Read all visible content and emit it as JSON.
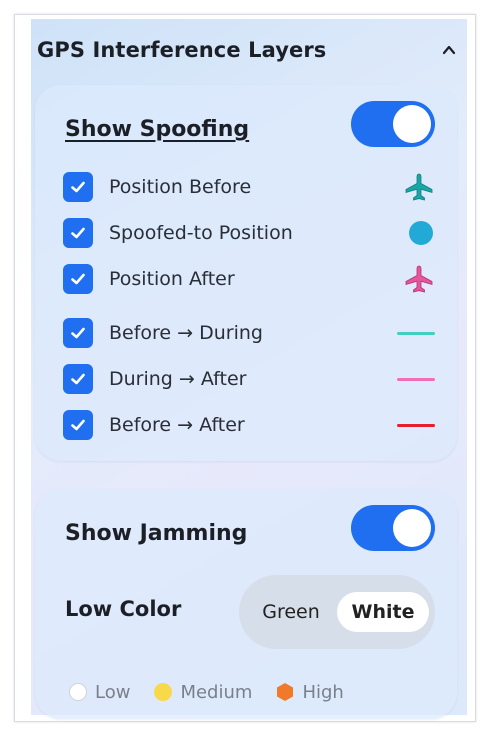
{
  "panel": {
    "title": "GPS Interference Layers",
    "collapse_icon": "chevron-up-icon"
  },
  "spoofing": {
    "title": "Show Spoofing",
    "toggle_on": true,
    "items": [
      {
        "label": "Position Before",
        "checked": true,
        "symbol": "airplane-icon",
        "color": "#1aa6a6"
      },
      {
        "label": "Spoofed-to Position",
        "checked": true,
        "symbol": "circle",
        "color": "#22a9d6"
      },
      {
        "label": "Position After",
        "checked": true,
        "symbol": "airplane-icon",
        "color": "#e8559a"
      },
      {
        "label": "Before → During",
        "checked": true,
        "symbol": "line",
        "color": "#3fd0bf"
      },
      {
        "label": "During → After",
        "checked": true,
        "symbol": "line",
        "color": "#f06fb8"
      },
      {
        "label": "Before → After",
        "checked": true,
        "symbol": "line",
        "color": "#e61e2e"
      }
    ]
  },
  "jamming": {
    "title": "Show Jamming",
    "toggle_on": true,
    "low_color_label": "Low Color",
    "options": [
      "Green",
      "White"
    ],
    "selected_option": "White",
    "legend": [
      {
        "label": "Low",
        "color": "#ffffff"
      },
      {
        "label": "Medium",
        "color": "#f7d94a"
      },
      {
        "label": "High",
        "color": "#f07a2a"
      }
    ]
  },
  "colors": {
    "accent": "#1f6ff0"
  }
}
